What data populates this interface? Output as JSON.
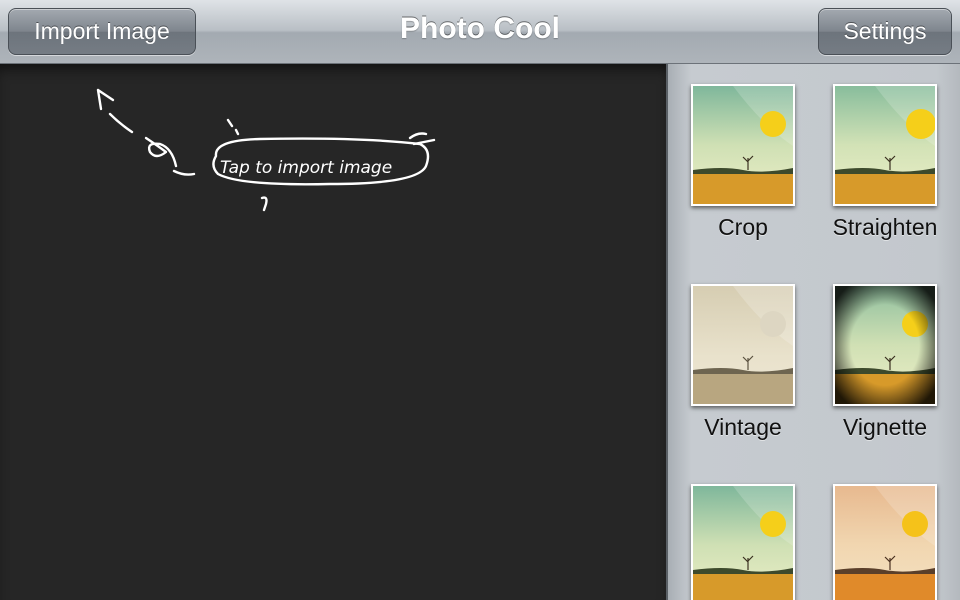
{
  "header": {
    "title": "Photo Cool",
    "import_button": "Import Image",
    "settings_button": "Settings"
  },
  "canvas": {
    "hint_text": "Tap to import image"
  },
  "effects": [
    {
      "label": "Crop"
    },
    {
      "label": "Straighten"
    },
    {
      "label": "Vintage"
    },
    {
      "label": "Vignette"
    },
    {
      "label": ""
    },
    {
      "label": ""
    }
  ],
  "colors": {
    "canvas_bg": "#262626",
    "toolbar": "#b9bfc5",
    "panel": "#c3c8cd",
    "sun": "#f5cf1a",
    "ground": "#d79a2a"
  }
}
